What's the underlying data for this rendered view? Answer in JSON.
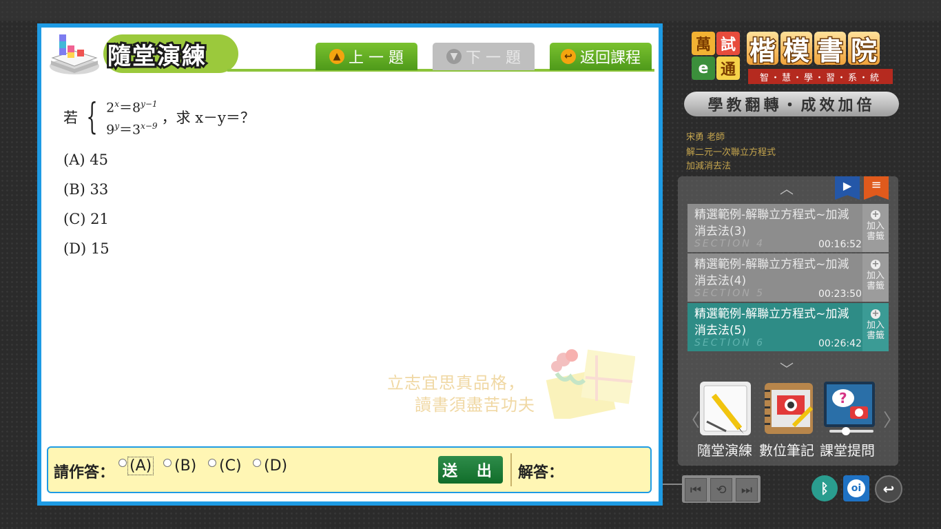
{
  "exercise": {
    "title": "隨堂演練",
    "nav": {
      "prev": "上 一 題",
      "next": "下 一 題",
      "back": "返回課程"
    },
    "question": {
      "prefix": "若",
      "eq1_left": "2",
      "eq1_left_exp": "x",
      "eq1_mid": "＝8",
      "eq1_right_exp": "y−1",
      "eq2_left": "9",
      "eq2_left_exp": "y",
      "eq2_mid": "＝3",
      "eq2_right_exp": "x−9",
      "tail": "，求 x－y＝？"
    },
    "options": [
      "(A) 45",
      "(B) 33",
      "(C) 21",
      "(D) 15"
    ],
    "motto_line1": "立志宜思真品格，",
    "motto_line2": "讀書須盡苦功夫"
  },
  "answer_bar": {
    "prompt": "請作答：",
    "choices": [
      "(A)",
      "(B)",
      "(C)",
      "(D)"
    ],
    "submit": "送 出",
    "solution_label": "解答："
  },
  "brand": {
    "logo_tiles": [
      "萬",
      "試",
      "e",
      "通"
    ],
    "name_chars": [
      "楷",
      "模",
      "書",
      "院"
    ],
    "subtitle": "智・慧・學・習・系・統",
    "slogan": "學教翻轉・成效加倍"
  },
  "course": {
    "teacher": "宋勇  老師",
    "topic": "解二元一次聯立方程式",
    "method": "加減消去法"
  },
  "playlist": {
    "up_glyph": "︿",
    "down_glyph": "﹀",
    "bookmark_label": "加入書籤",
    "items": [
      {
        "title": "精選範例-解聯立方程式~加減消去法(3)",
        "section": "SECTION 4",
        "time": "00:16:52",
        "active": false
      },
      {
        "title": "精選範例-解聯立方程式~加減消去法(4)",
        "section": "SECTION 5",
        "time": "00:23:50",
        "active": false
      },
      {
        "title": "精選範例-解聯立方程式~加減消去法(5)",
        "section": "SECTION 6",
        "time": "00:26:42",
        "active": true
      }
    ]
  },
  "tools": {
    "items": [
      {
        "label": "隨堂演練",
        "icon": "pencil-notebook-icon"
      },
      {
        "label": "數位筆記",
        "icon": "photo-notebook-icon"
      },
      {
        "label": "課堂提問",
        "icon": "question-camera-icon"
      }
    ],
    "left_glyph": "〈",
    "right_glyph": "〉"
  },
  "controls": {
    "icons": [
      "skip-back-icon",
      "repeat-icon",
      "skip-forward-icon",
      "bluetooth-icon",
      "oi-app-icon",
      "return-icon"
    ]
  },
  "colors": {
    "frame_blue": "#1e9be4",
    "nav_green": "#5aa622",
    "active_teal": "#2e8c86",
    "submit_green": "#116d2a",
    "answer_bg": "#fff6b4"
  }
}
